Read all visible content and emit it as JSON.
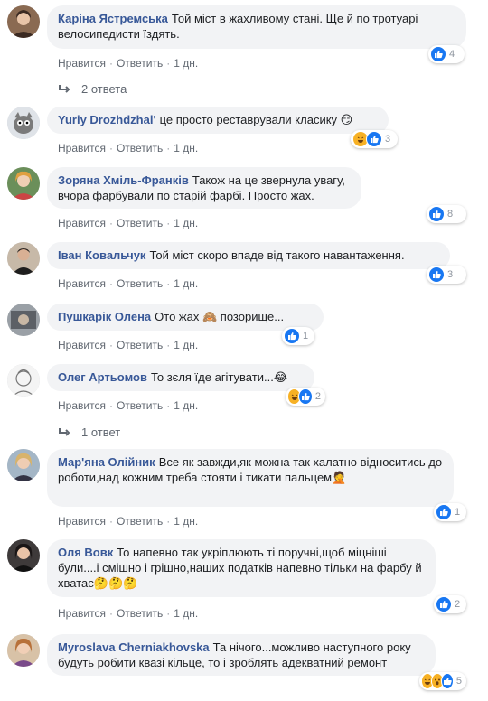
{
  "actions": {
    "like": "Нравится",
    "reply": "Ответить",
    "sep": "·"
  },
  "colors": {
    "author": "#385898",
    "bubble": "#f2f3f5",
    "like": "#1877f2"
  },
  "comments": [
    {
      "author": "Каріна Ястремська",
      "text": "Той міст в жахливому стані. Ще й по тротуарі велосипедисти їздять.",
      "time": "1 дн.",
      "reactions": [
        "like"
      ],
      "count": "4",
      "replies": "2 ответа"
    },
    {
      "author": "Yuriy Drozhdzhal'",
      "text": "це просто реставрували класику",
      "emoji": "😏",
      "time": "1 дн.",
      "reactions": [
        "haha",
        "like"
      ],
      "count": "3"
    },
    {
      "author": "Зоряна Хміль-Франків",
      "text": "Також на це звернула увагу, вчора фарбували по старій фарбі. Просто жах.",
      "time": "1 дн.",
      "reactions": [
        "like"
      ],
      "count": "8"
    },
    {
      "author": "Іван Ковальчук",
      "text": "Той міст скоро впаде від такого навантаження.",
      "time": "1 дн.",
      "reactions": [
        "like"
      ],
      "count": "3"
    },
    {
      "author": "Пушкарік Олена",
      "text": "Ото жах",
      "emoji_mid": "🙈",
      "text2": "позорище...",
      "time": "1 дн.",
      "reactions": [
        "like"
      ],
      "count": "1"
    },
    {
      "author": "Олег Артьомов",
      "text": "То зєля їде агітувати...",
      "emoji": "😂",
      "time": "1 дн.",
      "reactions": [
        "haha",
        "like"
      ],
      "count": "2",
      "replies": "1 ответ"
    },
    {
      "author": "Мар'яна Олійник",
      "text": "Все як завжди,як можна так халатно відноситись до роботи,над кожним треба стояти і тикати пальцем",
      "emoji": "🤦",
      "time": "1 дн.",
      "reactions": [
        "like"
      ],
      "count": "1"
    },
    {
      "author": "Оля Вовк",
      "text": "То напевно так укріплюють ті поручні,щоб міцніші були....і смішно і грішно,наших податків напевно тільки на фарбу й хватає",
      "emoji": "🤔🤔🤔",
      "time": "1 дн.",
      "reactions": [
        "like"
      ],
      "count": "2"
    },
    {
      "author": "Myroslava Cherniakhovska",
      "text": "Та нічого...можливо наступного року будуть робити квазі кільце, то і зроблять адекватний ремонт",
      "time": "",
      "reactions": [
        "haha",
        "wow",
        "like"
      ],
      "count": "5"
    }
  ]
}
